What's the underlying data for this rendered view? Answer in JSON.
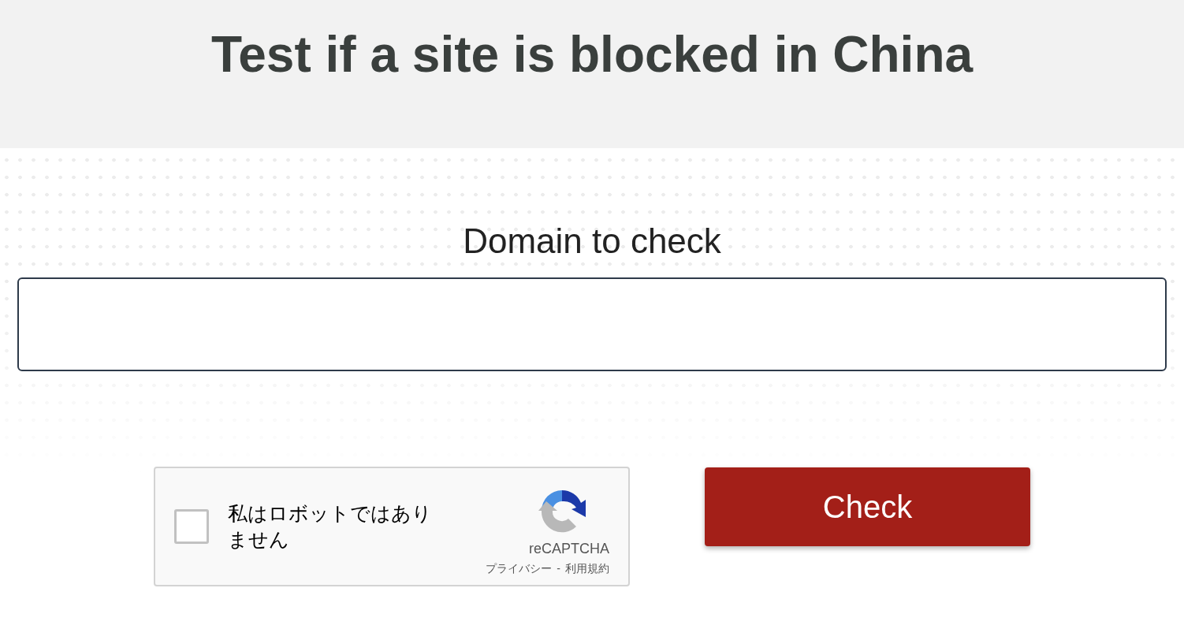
{
  "header": {
    "title": "Test if a site is blocked in China"
  },
  "form": {
    "label": "Domain to check"
  },
  "captcha": {
    "checked": false,
    "label": "私はロボットではありません",
    "brand": "reCAPTCHA",
    "privacy_link": "プライバシー",
    "separator": "-",
    "terms_link": "利用規約"
  },
  "submit_button": {
    "label": "Check"
  }
}
